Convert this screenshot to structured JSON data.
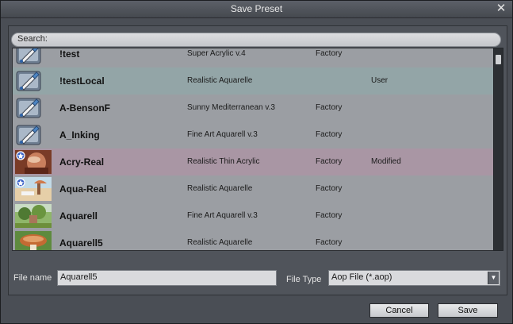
{
  "window": {
    "title": "Save Preset",
    "close_glyph": "✕"
  },
  "search": {
    "label": "Search:"
  },
  "presets": [
    {
      "name": "!test",
      "base": "Super Acrylic v.4",
      "source": "Factory",
      "state": "",
      "thumb": "brush-icon",
      "style": "default"
    },
    {
      "name": "!testLocal",
      "base": "Realistic Aquarelle",
      "source": "",
      "state": "User",
      "thumb": "brush-icon",
      "style": "user"
    },
    {
      "name": "A-BensonF",
      "base": "Sunny Mediterranean v.3",
      "source": "Factory",
      "state": "",
      "thumb": "brush-icon",
      "style": "default"
    },
    {
      "name": "A_Inking",
      "base": "Fine Art Aquarell v.3",
      "source": "Factory",
      "state": "",
      "thumb": "brush-icon",
      "style": "default"
    },
    {
      "name": "Acry-Real",
      "base": "Realistic Thin Acrylic",
      "source": "Factory",
      "state": "Modified",
      "thumb": "portrait-thumbnail",
      "style": "modified"
    },
    {
      "name": "Aqua-Real",
      "base": "Realistic Aquarelle",
      "source": "Factory",
      "state": "",
      "thumb": "beach-thumbnail",
      "style": "default"
    },
    {
      "name": "Aquarell",
      "base": "Fine Art Aquarell v.3",
      "source": "Factory",
      "state": "",
      "thumb": "garden-thumbnail",
      "style": "default"
    },
    {
      "name": "Aquarell5",
      "base": "Realistic Aquarelle",
      "source": "Factory",
      "state": "",
      "thumb": "mushroom-thumbnail",
      "style": "default"
    }
  ],
  "footer": {
    "file_name_label": "File name",
    "file_name_value": "Aquarell5",
    "file_type_label": "File Type",
    "file_type_value": "Aop File (*.aop)",
    "cancel_label": "Cancel",
    "save_label": "Save"
  },
  "colors": {
    "user_row": "#93a5a7",
    "modified_row": "#a996a4",
    "default_row": "#9b9ea3"
  }
}
